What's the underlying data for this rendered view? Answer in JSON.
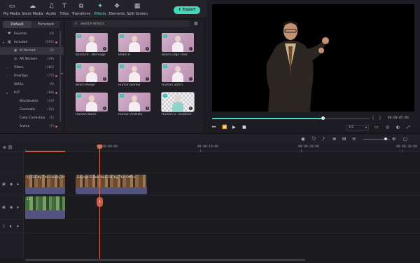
{
  "toolbar": {
    "tools": [
      {
        "label": "My Media",
        "icon": "folder-icon"
      },
      {
        "label": "Stock Media",
        "icon": "cloud-icon"
      },
      {
        "label": "Audio",
        "icon": "music-icon"
      },
      {
        "label": "Titles",
        "icon": "text-icon"
      },
      {
        "label": "Transitions",
        "icon": "transition-icon"
      },
      {
        "label": "Effects",
        "icon": "effects-icon",
        "active": true
      },
      {
        "label": "Elements",
        "icon": "elements-icon"
      },
      {
        "label": "Split Screen",
        "icon": "split-screen-icon"
      }
    ],
    "export_label": "Export"
  },
  "left_panel": {
    "tabs": [
      "Default",
      "Filmstock"
    ],
    "categories": [
      {
        "label": "Favorite",
        "count": "(0)"
      },
      {
        "label": "Included",
        "count": "(595)"
      },
      {
        "label": "AI Portrait",
        "count": "(9)"
      },
      {
        "label": "AR Stickers",
        "count": "(49)"
      },
      {
        "label": "Filters",
        "count": "(180)"
      },
      {
        "label": "Overlays",
        "count": "(77)"
      },
      {
        "label": "Utility",
        "count": "(9)"
      },
      {
        "label": "LUT",
        "count": "(68)"
      },
      {
        "label": "Blockbuster",
        "count": "(14)"
      },
      {
        "label": "Cinematic",
        "count": "(26)"
      },
      {
        "label": "Color Correction",
        "count": "(1)"
      },
      {
        "label": "Anime",
        "count": "(7)"
      }
    ]
  },
  "browser": {
    "search_placeholder": "Search effects",
    "effects": [
      "BackGro...Nermage",
      "Beam II",
      "Beam Edge Flow",
      "Beam Merge",
      "Human Border",
      "Human Stitch",
      "Human Noise",
      "Human Pixelate",
      "Human S...entation"
    ]
  },
  "preview": {
    "timecode": "00:00:05:06",
    "progress": 0.7,
    "quality": "1/2"
  },
  "ruler": {
    "times": [
      "00:00:00:00",
      "00:00:10:00",
      "00:00:20:00",
      "00:00:30:00"
    ]
  },
  "tracks": {
    "clip1_title": "lly GIF by The Lonely Isl",
    "clip2_title": "George S Reaction GIF by The Office",
    "clip3_title": "12"
  },
  "colors": {
    "accent": "#43d8b8",
    "playhead": "#e0694e",
    "effect_thumb": "#c29cba",
    "audio_clip": "#53537d"
  }
}
